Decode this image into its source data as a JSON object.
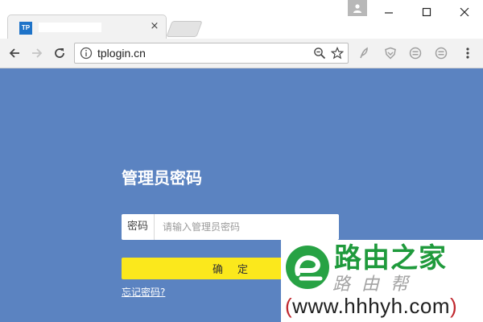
{
  "browser": {
    "tab": {
      "favicon_text": "TP",
      "close_glyph": "×"
    },
    "address_bar": {
      "url": "tplogin.cn"
    }
  },
  "login": {
    "title": "管理员密码",
    "password_label": "密码",
    "password_placeholder": "请输入管理员密码",
    "password_value": "",
    "confirm_label": "确定",
    "forgot_link": "忘记密码?"
  },
  "watermark": {
    "brand": "路由之家",
    "sub": "路由帮",
    "url_open": "(",
    "url": "www.hhhyh.com",
    "url_close": ")"
  },
  "colors": {
    "page_background": "#5b83c1",
    "confirm_button": "#fbe81c",
    "favicon": "#1e73c8",
    "watermark_green": "#1f9a3c"
  },
  "icons": [
    "back-arrow-icon",
    "forward-arrow-icon",
    "reload-icon",
    "info-icon",
    "zoom-icon",
    "star-icon",
    "extension-icons",
    "menu-icon"
  ]
}
